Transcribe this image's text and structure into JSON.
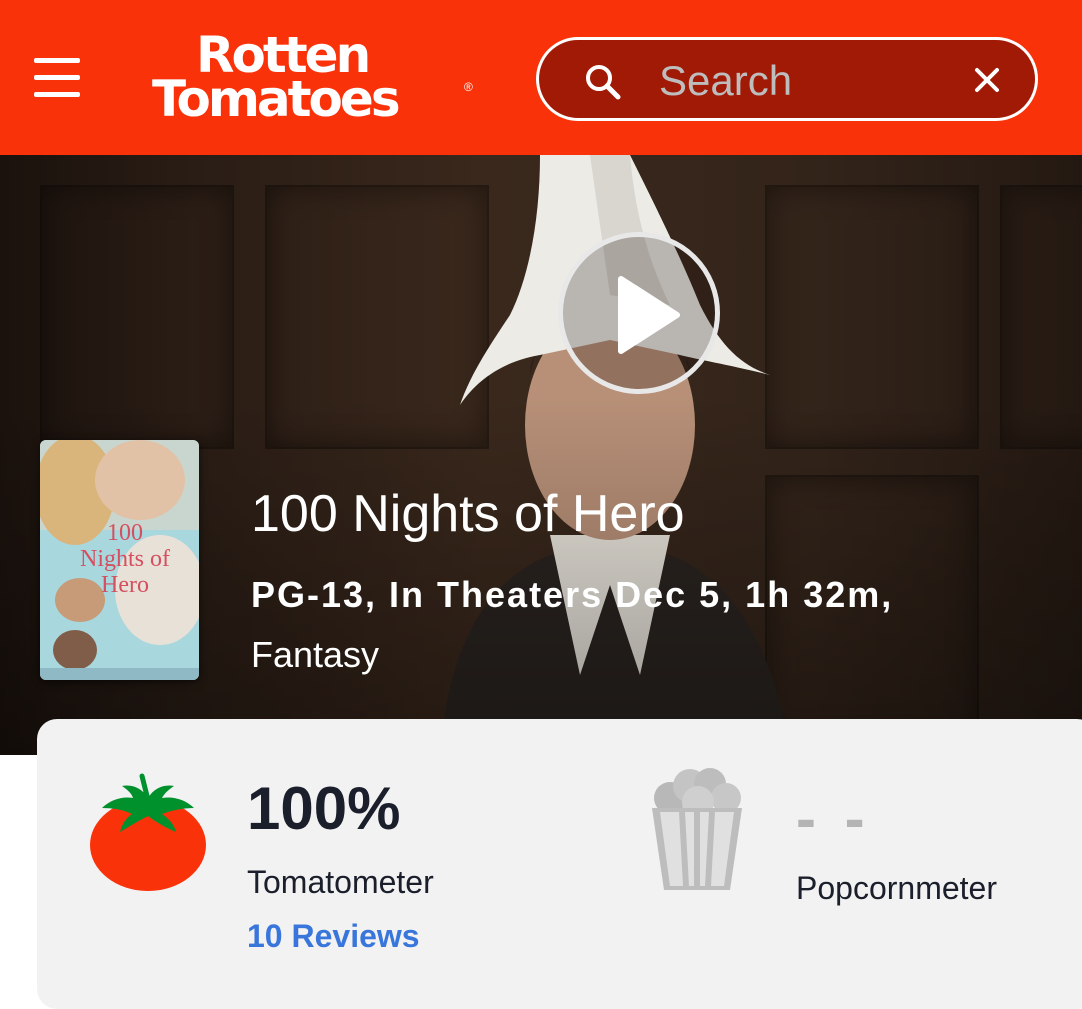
{
  "header": {
    "logo_line1": "Rotten",
    "logo_line2": "Tomatoes",
    "logo_mark": "®",
    "search_placeholder": "Search",
    "menu_icon": "hamburger-menu-icon",
    "search_icon": "search-icon",
    "clear_icon": "close-icon",
    "brand_color": "#fa320a"
  },
  "hero": {
    "play_icon": "play-icon",
    "poster_title_lettering": "100 Nights of Hero"
  },
  "movie": {
    "title": "100 Nights of Hero",
    "meta": "PG-13, In Theaters Dec 5, 1h 32m,",
    "genre": "Fantasy"
  },
  "scores": {
    "tomatometer": {
      "value": "100%",
      "label": "Tomatometer",
      "reviews_link": "10 Reviews",
      "icon": "fresh-tomato-icon"
    },
    "popcornmeter": {
      "value": "- -",
      "label": "Popcornmeter",
      "icon": "popcorn-bucket-icon"
    }
  }
}
